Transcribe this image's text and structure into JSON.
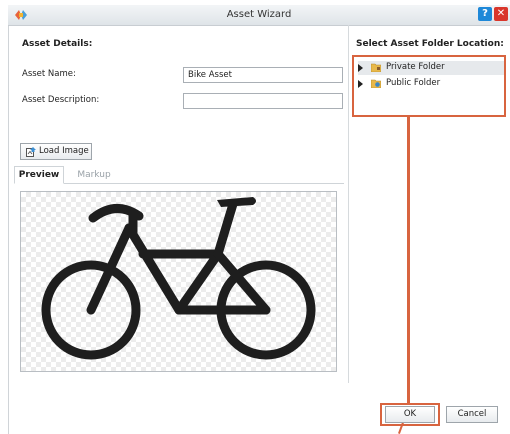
{
  "window": {
    "title": "Asset Wizard",
    "help_label": "?",
    "close_label": "✕"
  },
  "details": {
    "heading": "Asset Details:",
    "name_label": "Asset Name:",
    "name_value": "Bike Asset",
    "description_label": "Asset Description:",
    "description_value": "",
    "load_image_label": "Load Image"
  },
  "tabs": [
    {
      "label": "Preview",
      "active": true
    },
    {
      "label": "Markup",
      "active": false
    }
  ],
  "preview": {
    "image": "bicycle-icon"
  },
  "folders": {
    "heading": "Select Asset Folder Location:",
    "items": [
      {
        "label": "Private Folder",
        "icon": "private-folder-icon",
        "selected": true
      },
      {
        "label": "Public Folder",
        "icon": "public-folder-icon",
        "selected": false
      }
    ]
  },
  "footer": {
    "ok_label": "OK",
    "cancel_label": "Cancel"
  },
  "colors": {
    "annotation": "#d8643f",
    "help": "#1e88d8",
    "close": "#d9362b"
  }
}
